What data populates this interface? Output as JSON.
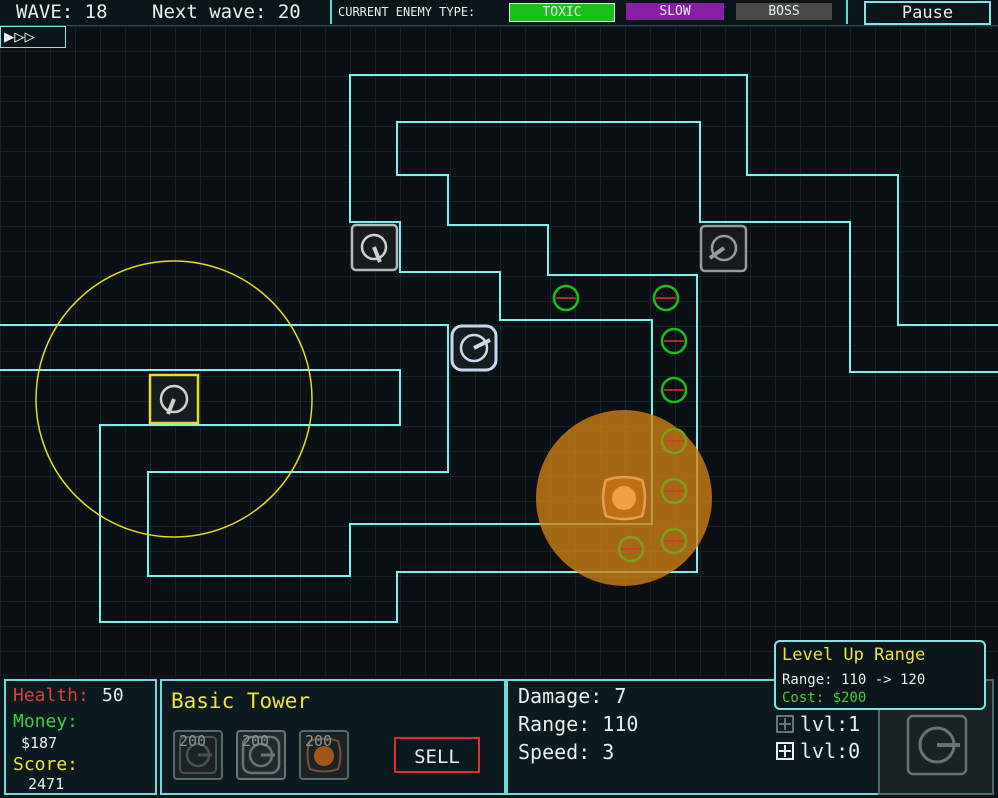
{
  "topbar": {
    "wave_label": "WAVE: 18",
    "next_wave_label": "Next wave: 20",
    "enemy_type_label": "CURRENT ENEMY TYPE:",
    "enemy_types": [
      {
        "label": "TOXIC",
        "color": "#19c019"
      },
      {
        "label": "SLOW",
        "color": "#8a1ea8"
      },
      {
        "label": "BOSS",
        "color": "#4a4a4a"
      }
    ],
    "pause_label": "Pause"
  },
  "speed_control": {
    "label": "▶▷▷"
  },
  "status": {
    "health_label": "Health:",
    "health_value": "50",
    "money_label": "Money:",
    "money_value": "$187",
    "score_label": "Score:",
    "score_value": "2471"
  },
  "shop": {
    "title": "Basic Tower",
    "items": [
      {
        "cost": "200",
        "icon": "basic-tower-icon"
      },
      {
        "cost": "200",
        "icon": "basic-tower-icon"
      },
      {
        "cost": "200",
        "icon": "area-tower-icon"
      }
    ],
    "sell_label": "SELL"
  },
  "tower_stats": {
    "damage": "Damage: 7",
    "range": "Range: 110",
    "speed": "Speed: 3",
    "level_1": "lvl:1",
    "level_2": "lvl:0"
  },
  "tooltip": {
    "title": "Level Up Range",
    "detail": "Range: 110 -> 120",
    "cost": "Cost: $200"
  },
  "colors": {
    "path_outline": "#7ef0f0",
    "health": "#e03c3c",
    "money": "#3cd23c",
    "score": "#f0e040",
    "accent": "#6fdada",
    "selected_range": "#e6dc1e",
    "area_tower": "#d08214"
  }
}
